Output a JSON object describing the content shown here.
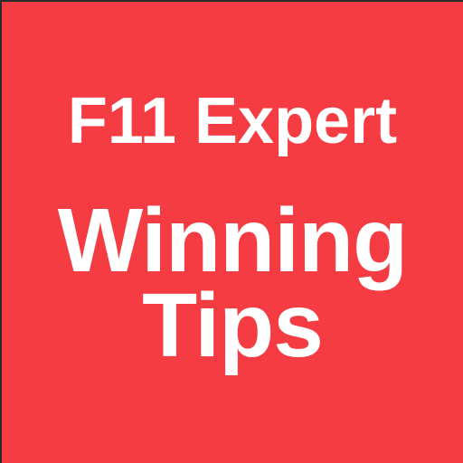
{
  "tile": {
    "background_color": "#F43C42",
    "text_color": "#FFFFFF",
    "line1": "F11 Expert",
    "line2": "Winning",
    "line3": "Tips"
  }
}
